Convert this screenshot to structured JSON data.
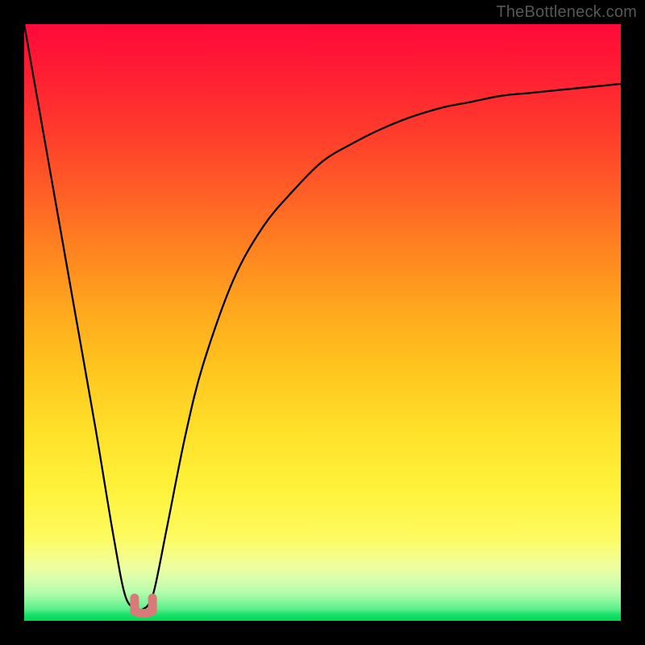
{
  "watermark": "TheBottleneck.com",
  "chart_data": {
    "type": "line",
    "title": "",
    "xlabel": "",
    "ylabel": "",
    "xlim": [
      0,
      100
    ],
    "ylim": [
      0,
      100
    ],
    "grid": false,
    "legend": false,
    "curve_note": "Single black curve rendered over a vertical red→green heat gradient. Values below are approximate readings of the curve height across x, expressed as percent of the plot height from bottom.",
    "x": [
      0,
      3,
      6,
      9,
      12,
      15,
      17,
      19,
      20,
      21,
      22,
      24,
      27,
      30,
      35,
      40,
      45,
      50,
      55,
      60,
      65,
      70,
      75,
      80,
      85,
      90,
      95,
      100
    ],
    "y": [
      100,
      83,
      66,
      49,
      32,
      14,
      4,
      2,
      2,
      3,
      6,
      16,
      31,
      43,
      57,
      66,
      72,
      77,
      80,
      82.5,
      84.5,
      86,
      87,
      88,
      88.5,
      89,
      89.5,
      90
    ],
    "series": [
      {
        "name": "bottleneck-curve",
        "color": "#000000"
      }
    ],
    "markers": {
      "note": "Two short salmon/pink segments near the curve minimum",
      "color": "#d97a78",
      "points": [
        {
          "x": 18.5,
          "y": 3
        },
        {
          "x": 21.5,
          "y": 3
        }
      ]
    }
  }
}
